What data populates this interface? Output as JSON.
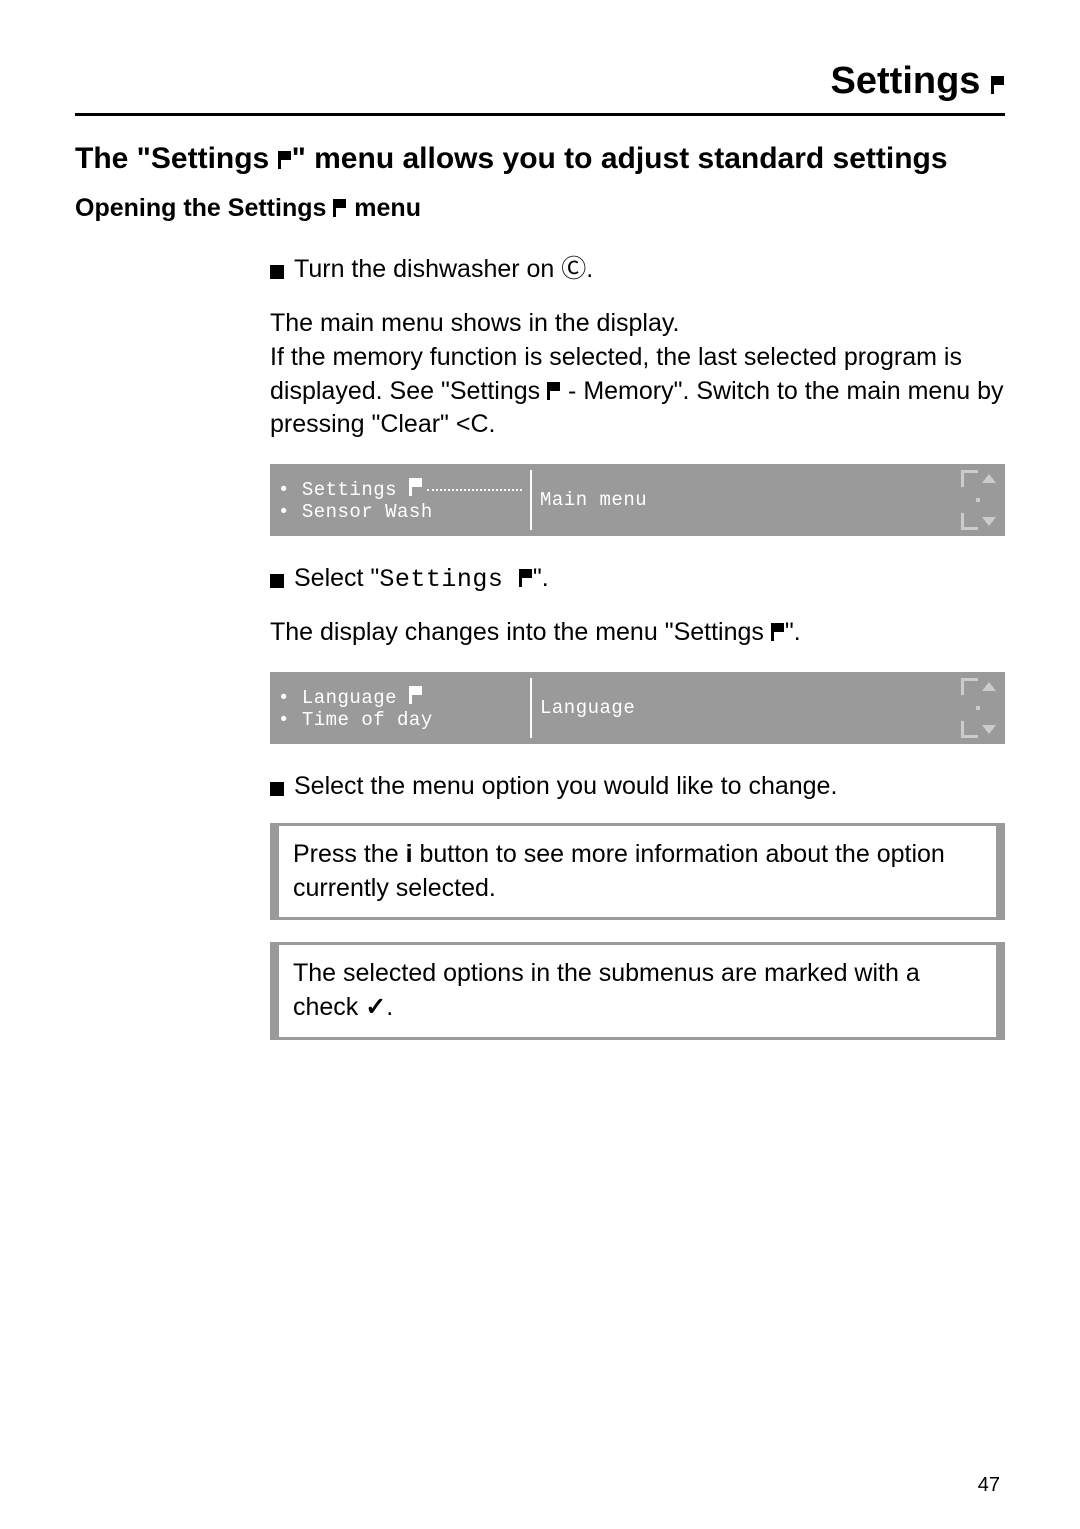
{
  "header": {
    "title": "Settings"
  },
  "intro": {
    "prefix": "The \"Settings ",
    "suffix": "\" menu allows you to adjust standard settings"
  },
  "subhead": {
    "prefix": "Opening the Settings ",
    "suffix": " menu"
  },
  "step1": {
    "prefix": "Turn the dishwasher on ",
    "symbol_name": "power-icon",
    "symbol": "Ⓘ",
    "suffix": "."
  },
  "para1": {
    "line1": "The main menu shows in the display.",
    "line2a": "If the memory function is selected, the last selected program is displayed. See \"Settings ",
    "line2b": " - Memory\". Switch to the main menu by pressing \"Clear\" ",
    "clear_sym": "<C",
    "line2c": "."
  },
  "lcd_main": {
    "item1": "Settings",
    "item2": "Sensor Wash",
    "center": "Main menu"
  },
  "step2": {
    "prefix": "Select \"",
    "settings_word": "Settings ",
    "suffix": "\"."
  },
  "para2": {
    "a": "The display changes into the menu \"Settings ",
    "b": "\"."
  },
  "lcd_settings": {
    "item1": "Language ",
    "item2": "Time of day",
    "center": "Language"
  },
  "step3": "Select the menu option you would like to change.",
  "note1": {
    "a": "Press the ",
    "info": "i",
    "b": " button to see more information about the option currently selected."
  },
  "note2": {
    "a": "The selected options in the submenus are marked with a check ",
    "check": "✓",
    "b": "."
  },
  "page_number": "47"
}
